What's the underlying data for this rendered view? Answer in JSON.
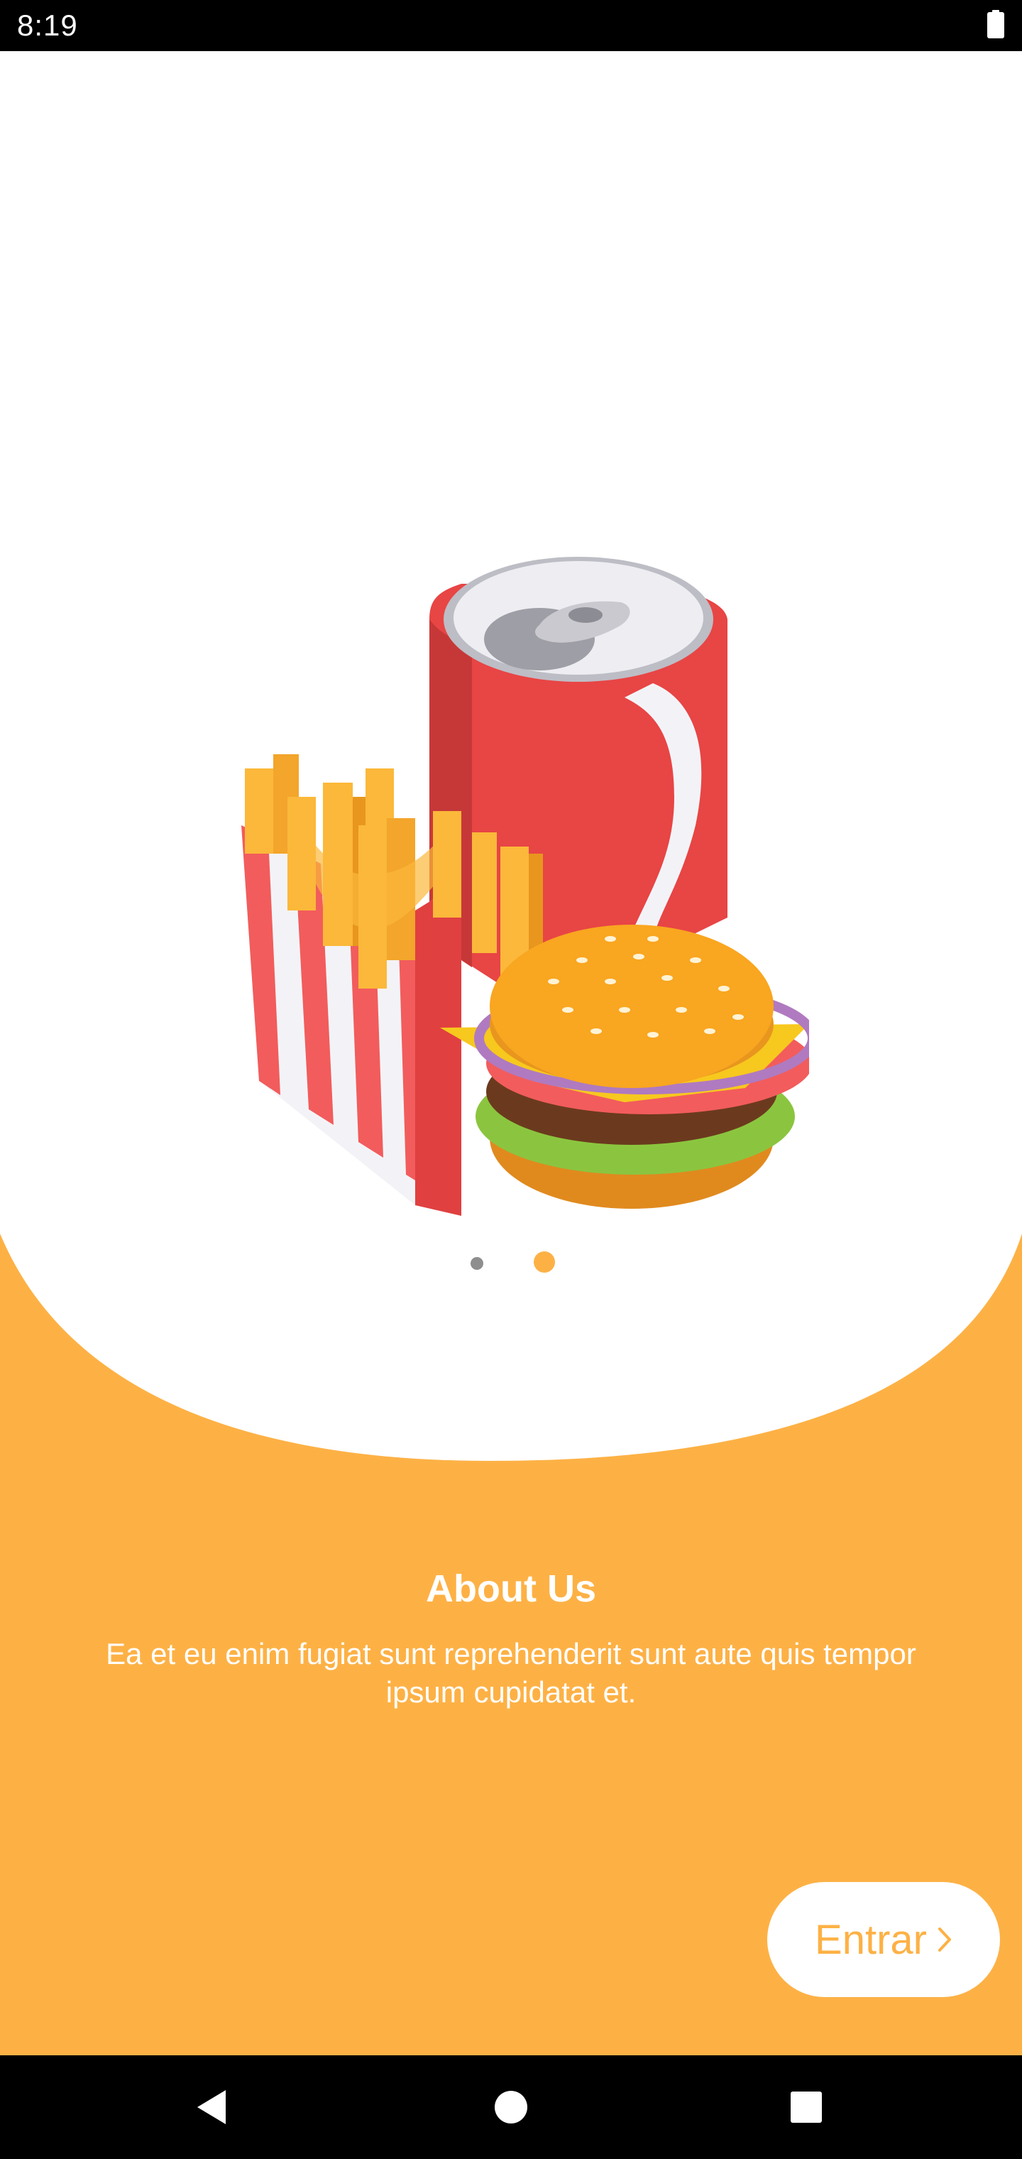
{
  "status_bar": {
    "time": "8:19",
    "battery_icon": "battery-full-icon"
  },
  "onboarding": {
    "illustration": "fast-food-illustration",
    "page_indicator": {
      "total": 2,
      "active_index": 1,
      "active_color": "#FDB145",
      "inactive_color": "#8E8E8E"
    },
    "title": "About Us",
    "description": "Ea et eu enim fugiat sunt reprehenderit sunt aute quis tempor ipsum cupidatat et.",
    "enter_button": {
      "label": "Entrar",
      "icon": "chevron-right-icon"
    }
  },
  "colors": {
    "accent": "#FDB145",
    "background": "#FFFFFF",
    "system_bars": "#000000"
  },
  "nav_bar": {
    "back_icon": "back-triangle-icon",
    "home_icon": "home-circle-icon",
    "recents_icon": "recents-square-icon"
  }
}
